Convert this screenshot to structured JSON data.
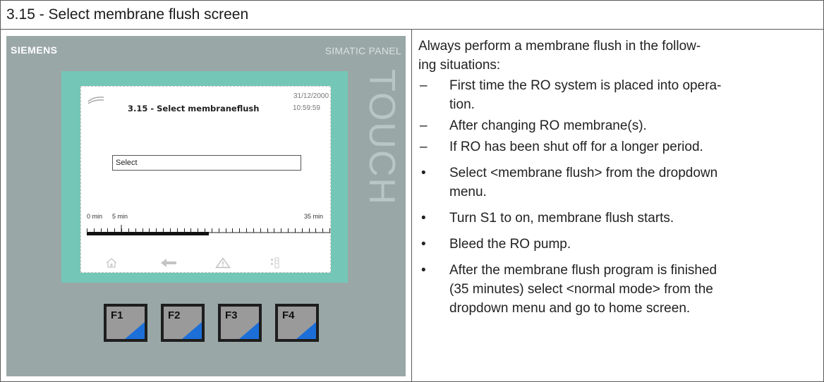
{
  "header": {
    "title": "3.15 - Select membrane flush screen"
  },
  "panel": {
    "logo": "SIEMENS",
    "brand": "SIMATIC PANEL",
    "touch": "TOUCH",
    "screen": {
      "title": "3.15 - Select membraneflush",
      "date": "31/12/2000",
      "time": "10:59:59",
      "select_value": "Select",
      "timeline": {
        "start_label": "0 min",
        "mid_label": "5 min",
        "end_label": "35 min",
        "progress": 0.5
      },
      "nav_icons": [
        "home-icon",
        "back-arrow-icon",
        "warning-icon",
        "settings-icon"
      ]
    },
    "function_keys": [
      "F1",
      "F2",
      "F3",
      "F4"
    ]
  },
  "instructions": {
    "intro": "Always perform a membrane flush in the following situations:",
    "intro_line1": "Always perform a membrane flush in the follow-",
    "intro_line2": "ing situations:",
    "situations": [
      {
        "line1": "First time the RO system is placed into opera-",
        "line2": "tion."
      },
      {
        "line1": "After changing RO membrane(s).",
        "line2": ""
      },
      {
        "line1": "If RO has been shut off for a longer period.",
        "line2": ""
      }
    ],
    "steps": [
      {
        "line1": "Select <membrane flush> from the dropdown",
        "line2": "menu."
      },
      {
        "line1": "Turn S1 to on, membrane flush starts.",
        "line2": ""
      },
      {
        "line1": "Bleed the RO pump.",
        "line2": ""
      },
      {
        "line1": "After the membrane flush program is finished",
        "line2": "(35 minutes) select <normal mode> from the",
        "line3": "dropdown menu and go to home screen."
      }
    ]
  }
}
